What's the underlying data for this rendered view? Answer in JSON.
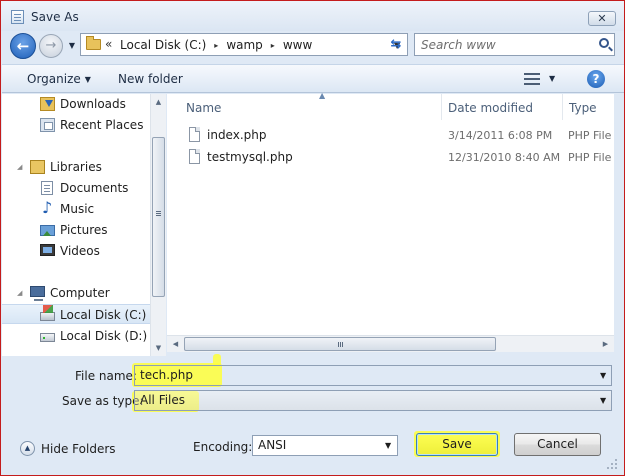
{
  "window": {
    "title": "Save As",
    "close_glyph": "✕"
  },
  "address_bar": {
    "overflow_glyph": "«",
    "crumbs": [
      "Local Disk (C:)",
      "wamp",
      "www"
    ],
    "separator_glyph": "▸",
    "dropdown_glyph": "▼"
  },
  "search": {
    "placeholder": "Search www"
  },
  "toolbar": {
    "organize_label": "Organize",
    "new_folder_label": "New folder",
    "caret_glyph": "▼",
    "help_glyph": "?"
  },
  "nav_pane": {
    "items": [
      {
        "label": "Downloads",
        "icon": "downloads-icon"
      },
      {
        "label": "Recent Places",
        "icon": "recent-places-icon"
      },
      {
        "label": "Libraries",
        "icon": "libraries-icon"
      },
      {
        "label": "Documents",
        "icon": "documents-icon"
      },
      {
        "label": "Music",
        "icon": "music-icon"
      },
      {
        "label": "Pictures",
        "icon": "pictures-icon"
      },
      {
        "label": "Videos",
        "icon": "videos-icon"
      },
      {
        "label": "Computer",
        "icon": "computer-icon"
      },
      {
        "label": "Local Disk (C:)",
        "icon": "local-disk-icon",
        "selected": true
      },
      {
        "label": "Local Disk (D:)",
        "icon": "local-disk-icon"
      }
    ]
  },
  "file_list": {
    "columns": [
      "Name",
      "Date modified",
      "Type"
    ],
    "sort_glyph": "▲",
    "rows": [
      {
        "name": "index.php",
        "date": "3/14/2011 6:08 PM",
        "type": "PHP File"
      },
      {
        "name": "testmysql.php",
        "date": "12/31/2010 8:40 AM",
        "type": "PHP File"
      }
    ]
  },
  "form": {
    "file_name_label": "File name:",
    "file_name_value": "tech.php",
    "save_type_label": "Save as type:",
    "save_type_value": "All Files",
    "encoding_label": "Encoding:",
    "encoding_value": "ANSI"
  },
  "buttons": {
    "hide_folders_label": "Hide Folders",
    "save_label": "Save",
    "cancel_label": "Cancel"
  },
  "colors": {
    "highlight": "#ffff3a",
    "window_border": "#c41c1c",
    "chrome": "#dfe9f5"
  }
}
